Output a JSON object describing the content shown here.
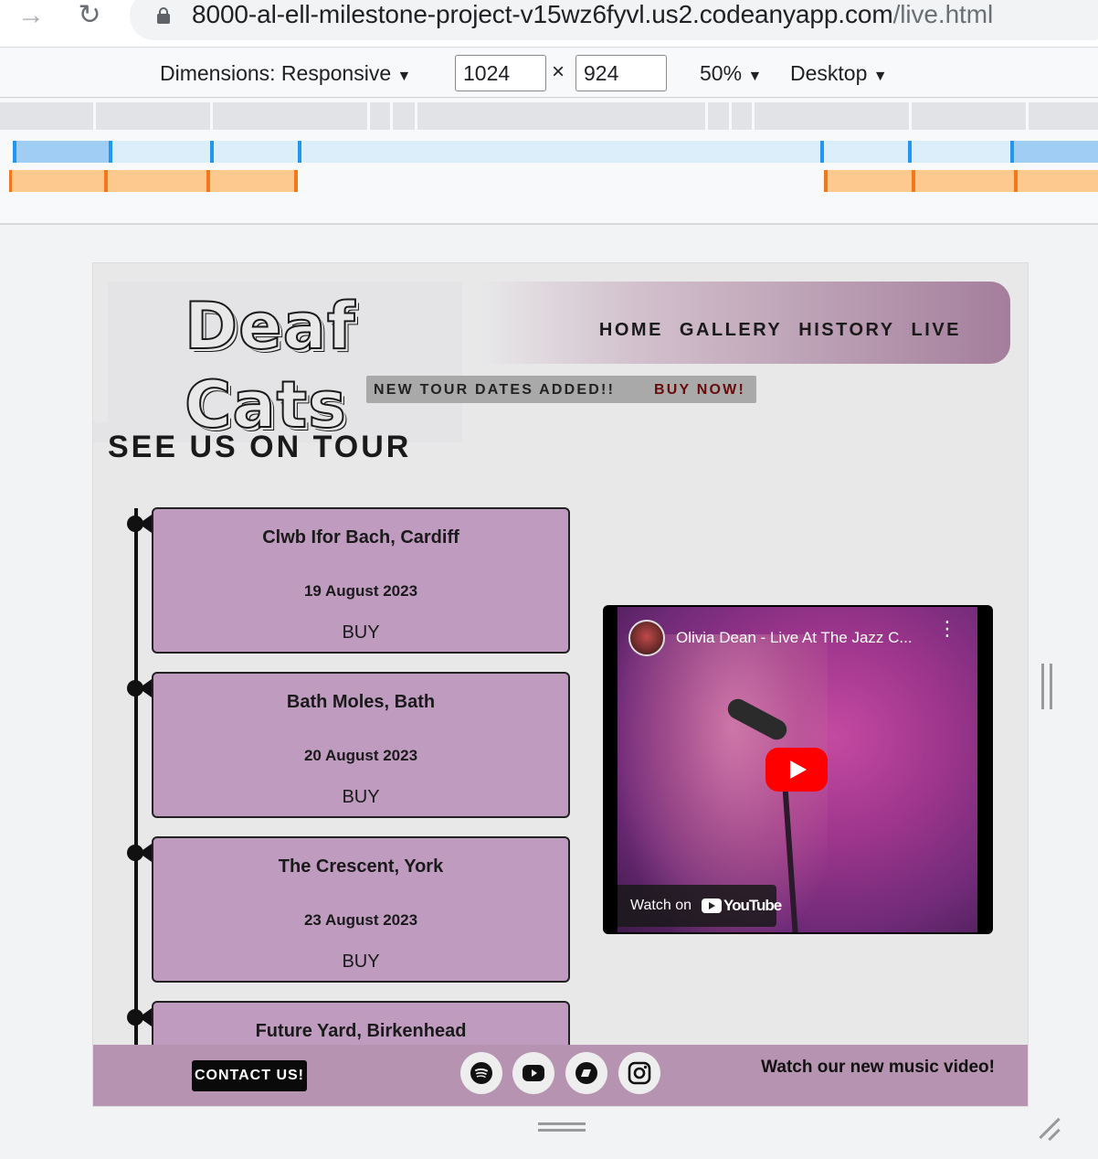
{
  "browser": {
    "url_host": "8000-al-ell-milestone-project-v15wz6fyvl.us2.codeanyapp.com",
    "url_path": "/live.html",
    "forward_icon": "arrow-right-icon",
    "reload_icon": "reload-icon",
    "lock_icon": "lock-icon"
  },
  "devtools": {
    "dimensions_label": "Dimensions: Responsive",
    "width": "1024",
    "height": "924",
    "times": "×",
    "zoom": "50%",
    "device": "Desktop",
    "dropdown_arrow": "▼"
  },
  "site": {
    "logo_line1": "Deaf",
    "logo_line2": "Cats",
    "nav": [
      "HOME",
      "GALLERY",
      "HISTORY",
      "LIVE"
    ],
    "banner_text": "NEW TOUR DATES ADDED!!",
    "banner_cta": "BUY NOW!",
    "heading": "SEE US ON TOUR",
    "tours": [
      {
        "venue": "Clwb Ifor Bach, Cardiff",
        "date": "19 August 2023",
        "cta": "BUY"
      },
      {
        "venue": "Bath Moles, Bath",
        "date": "20 August 2023",
        "cta": "BUY"
      },
      {
        "venue": "The Crescent, York",
        "date": "23 August 2023",
        "cta": "BUY"
      },
      {
        "venue": "Future Yard, Birkenhead",
        "date": "",
        "cta": ""
      }
    ],
    "video": {
      "title": "Olivia Dean - Live At The Jazz C...",
      "watch_on": "Watch on",
      "youtube": "YouTube",
      "more": "⋮"
    },
    "footer": {
      "contact": "CONTACT US!",
      "socials": [
        "spotify-icon",
        "youtube-icon",
        "bandcamp-icon",
        "instagram-icon"
      ],
      "cta": "Watch our new music video!"
    }
  },
  "colors": {
    "card": "#bf9bbf",
    "footer": "#b693b0",
    "accent": "#6a0a0a"
  }
}
